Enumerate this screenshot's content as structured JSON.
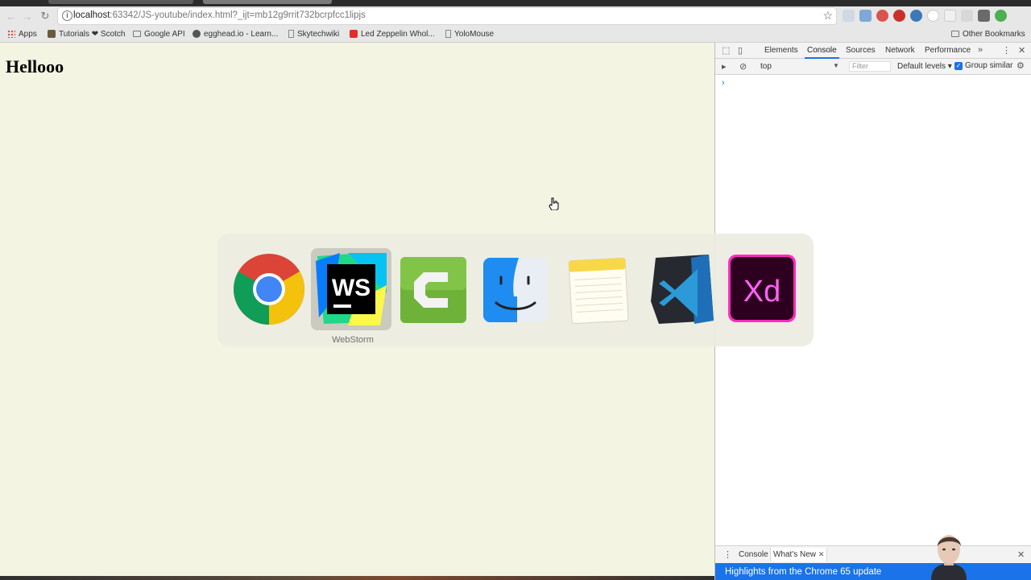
{
  "browser": {
    "url_host": "localhost",
    "url_path": ":63342/JS-youtube/index.html?_ijt=mb12g9rrit732bcrpfcc1lipjs",
    "bookmarks": [
      "Apps",
      "Tutorials ❤ Scotch",
      "Google API",
      "egghead.io - Learn...",
      "Skytechwiki",
      "Led Zeppelin Whol...",
      "YoloMouse"
    ],
    "other_bookmarks": "Other Bookmarks"
  },
  "page": {
    "heading": "Hellooo"
  },
  "devtools": {
    "tabs": [
      "Elements",
      "Console",
      "Sources",
      "Network",
      "Performance"
    ],
    "active_tab": "Console",
    "context": "top",
    "filter_placeholder": "Filter",
    "levels": "Default levels ▾",
    "group_similar": "Group similar",
    "prompt": "›",
    "drawer_tabs": [
      "Console",
      "What's New"
    ],
    "banner": "Highlights from the Chrome 65 update"
  },
  "app_switcher": {
    "apps": [
      {
        "name": "Google Chrome",
        "icon": "chrome-icon"
      },
      {
        "name": "WebStorm",
        "icon": "webstorm-icon"
      },
      {
        "name": "Camtasia",
        "icon": "camtasia-icon"
      },
      {
        "name": "Finder",
        "icon": "finder-icon"
      },
      {
        "name": "Notes",
        "icon": "notes-icon"
      },
      {
        "name": "Visual Studio Code",
        "icon": "vscode-icon"
      },
      {
        "name": "Adobe XD",
        "icon": "adobe-xd-icon"
      }
    ],
    "selected_label": "WebStorm"
  },
  "colors": {
    "page_bg": "#f4f4e2",
    "accent": "#1a73e8",
    "xd_pink": "#ff61f6",
    "xd_bg": "#2e001f"
  }
}
